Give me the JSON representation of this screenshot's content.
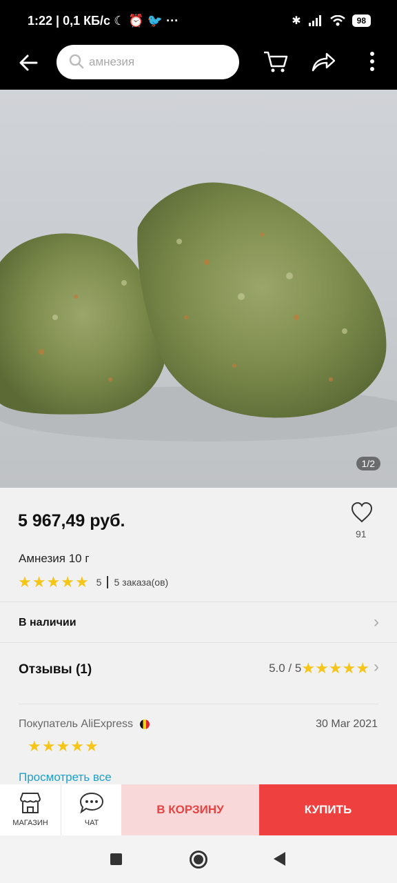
{
  "status_bar": {
    "time": "1:22",
    "speed": "| 0,1 КБ/с",
    "battery": "98"
  },
  "header": {
    "search_text": "амнезия",
    "icons": [
      "back-arrow-icon",
      "cart-icon",
      "share-icon",
      "more-icon"
    ]
  },
  "gallery": {
    "counter": "1/2"
  },
  "product": {
    "price": "5 967,49 руб.",
    "likes": "91",
    "title": "Амнезия 10 г",
    "rating": "5",
    "orders": "5 заказа(ов)",
    "stock": "В наличии"
  },
  "reviews": {
    "heading": "Отзывы (1)",
    "score": "5.0 / 5",
    "buyer": "Покупатель AliExpress",
    "date": "30 Mar 2021",
    "buyer_stars": 5,
    "view_all": "Просмотреть все"
  },
  "bottom_bar": {
    "shop_label": "МАГАЗИН",
    "chat_label": "ЧАТ",
    "cart_label": "В КОРЗИНУ",
    "buy_label": "КУПИТЬ"
  },
  "colors": {
    "accent_red": "#ef4040",
    "cart_bg": "#f8d8d8",
    "star": "#f5c518",
    "link": "#1da0c9"
  }
}
